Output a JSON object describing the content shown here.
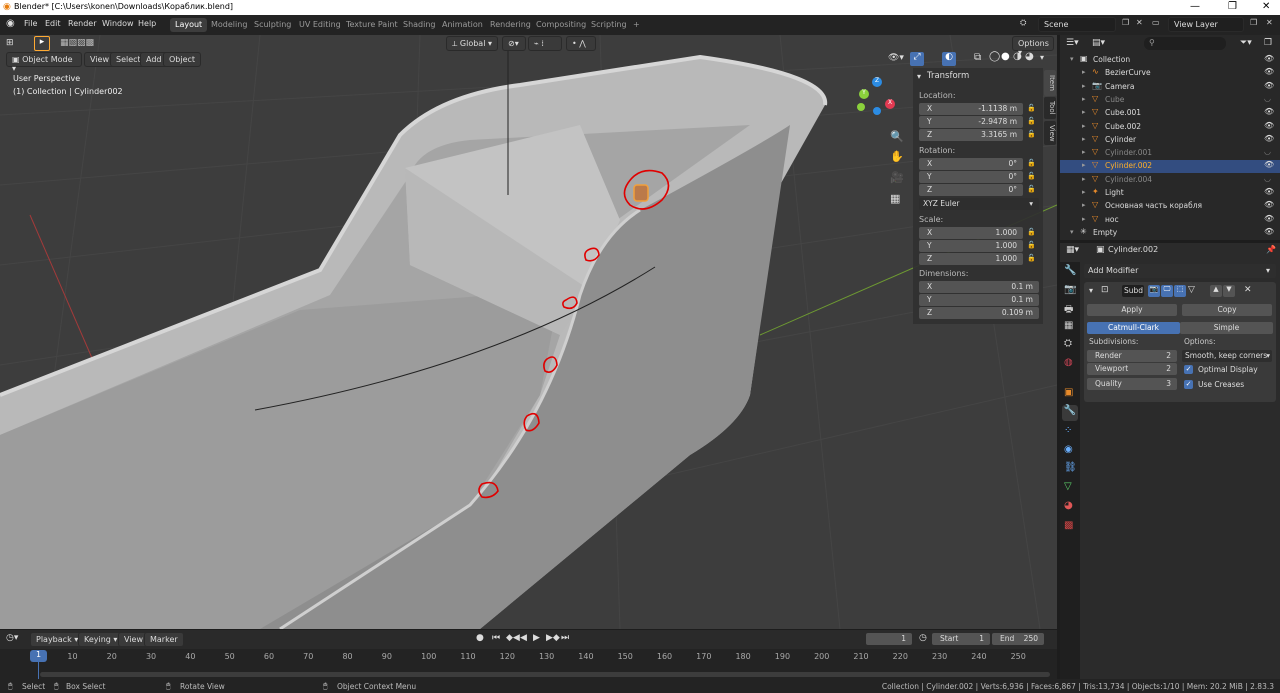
{
  "title_bar": {
    "title": "Blender* [C:\\Users\\konen\\Downloads\\Кораблик.blend]",
    "minimize": "—",
    "maximize": "❐",
    "close": "✕"
  },
  "menus": [
    "File",
    "Edit",
    "Render",
    "Window",
    "Help"
  ],
  "workspaces": [
    "Layout",
    "Modeling",
    "Sculpting",
    "UV Editing",
    "Texture Paint",
    "Shading",
    "Animation",
    "Rendering",
    "Compositing",
    "Scripting"
  ],
  "add_workspace": "+",
  "scene": "Scene",
  "view_layer": "View Layer",
  "viewport": {
    "orientation": "Global",
    "options": "Options",
    "mode": "Object Mode",
    "menus": [
      "View",
      "Select",
      "Add",
      "Object"
    ],
    "perspective": "User Perspective",
    "collection_info": "(1) Collection | Cylinder002",
    "gizmo": {
      "x": "X",
      "y": "Y",
      "z": "Z"
    }
  },
  "npanel": {
    "header": "Transform",
    "location_label": "Location:",
    "location": [
      {
        "axis": "X",
        "value": "-1.1138 m"
      },
      {
        "axis": "Y",
        "value": "-2.9478 m"
      },
      {
        "axis": "Z",
        "value": "3.3165 m"
      }
    ],
    "rotation_label": "Rotation:",
    "rotation": [
      {
        "axis": "X",
        "value": "0°"
      },
      {
        "axis": "Y",
        "value": "0°"
      },
      {
        "axis": "Z",
        "value": "0°"
      }
    ],
    "rotation_mode": "XYZ Euler",
    "scale_label": "Scale:",
    "scale": [
      {
        "axis": "X",
        "value": "1.000"
      },
      {
        "axis": "Y",
        "value": "1.000"
      },
      {
        "axis": "Z",
        "value": "1.000"
      }
    ],
    "dimensions_label": "Dimensions:",
    "dimensions": [
      {
        "axis": "X",
        "value": "0.1 m"
      },
      {
        "axis": "Y",
        "value": "0.1 m"
      },
      {
        "axis": "Z",
        "value": "0.109 m"
      }
    ],
    "tabs": [
      "Item",
      "Tool",
      "View"
    ]
  },
  "outliner": {
    "search_placeholder": "",
    "items": [
      {
        "name": "Collection",
        "level": 0,
        "dim": false,
        "selected": false
      },
      {
        "name": "BezierCurve",
        "level": 1,
        "dim": false,
        "selected": false
      },
      {
        "name": "Camera",
        "level": 1,
        "dim": false,
        "selected": false
      },
      {
        "name": "Cube",
        "level": 1,
        "dim": true,
        "selected": false
      },
      {
        "name": "Cube.001",
        "level": 1,
        "dim": false,
        "selected": false
      },
      {
        "name": "Cube.002",
        "level": 1,
        "dim": false,
        "selected": false
      },
      {
        "name": "Cylinder",
        "level": 1,
        "dim": false,
        "selected": false
      },
      {
        "name": "Cylinder.001",
        "level": 1,
        "dim": true,
        "selected": false
      },
      {
        "name": "Cylinder.002",
        "level": 1,
        "dim": false,
        "selected": true
      },
      {
        "name": "Cylinder.004",
        "level": 1,
        "dim": true,
        "selected": false
      },
      {
        "name": "Light",
        "level": 1,
        "dim": false,
        "selected": false
      },
      {
        "name": "Основная часть корабля",
        "level": 1,
        "dim": false,
        "selected": false
      },
      {
        "name": "нос",
        "level": 1,
        "dim": false,
        "selected": false
      },
      {
        "name": "Empty",
        "level": 0,
        "dim": false,
        "selected": false
      }
    ]
  },
  "properties": {
    "object_name": "Cylinder.002",
    "add_modifier": "Add Modifier",
    "modifier_name": "Subd",
    "apply": "Apply",
    "copy": "Copy",
    "catmull_clark": "Catmull-Clark",
    "simple": "Simple",
    "subdivisions_label": "Subdivisions:",
    "options_label": "Options:",
    "render_label": "Render",
    "render_value": "2",
    "viewport_label": "Viewport",
    "viewport_value": "2",
    "quality_label": "Quality",
    "quality_value": "3",
    "uv_smooth": "Smooth, keep corners",
    "optimal_display": "Optimal Display",
    "use_creases": "Use Creases"
  },
  "timeline": {
    "menus": [
      "Playback",
      "Keying",
      "View",
      "Marker"
    ],
    "current_frame": "1",
    "start_label": "Start",
    "start": "1",
    "end_label": "End",
    "end": "250",
    "ticks": [
      "1",
      "10",
      "20",
      "30",
      "40",
      "50",
      "60",
      "70",
      "80",
      "90",
      "100",
      "110",
      "120",
      "130",
      "140",
      "150",
      "160",
      "170",
      "180",
      "190",
      "200",
      "210",
      "220",
      "230",
      "240",
      "250"
    ]
  },
  "status_bar": {
    "select": "Select",
    "box_select": "Box Select",
    "rotate_view": "Rotate View",
    "context_menu": "Object Context Menu",
    "stats": "Collection | Cylinder.002 | Verts:6,936 | Faces:6,867 | Tris:13,734 | Objects:1/10 | Mem: 20.2 MiB | 2.83.3"
  },
  "colors": {
    "accent": "#4772b3",
    "selection": "#334d80",
    "active_object": "#ffaf29",
    "annotation": "#e00000"
  }
}
